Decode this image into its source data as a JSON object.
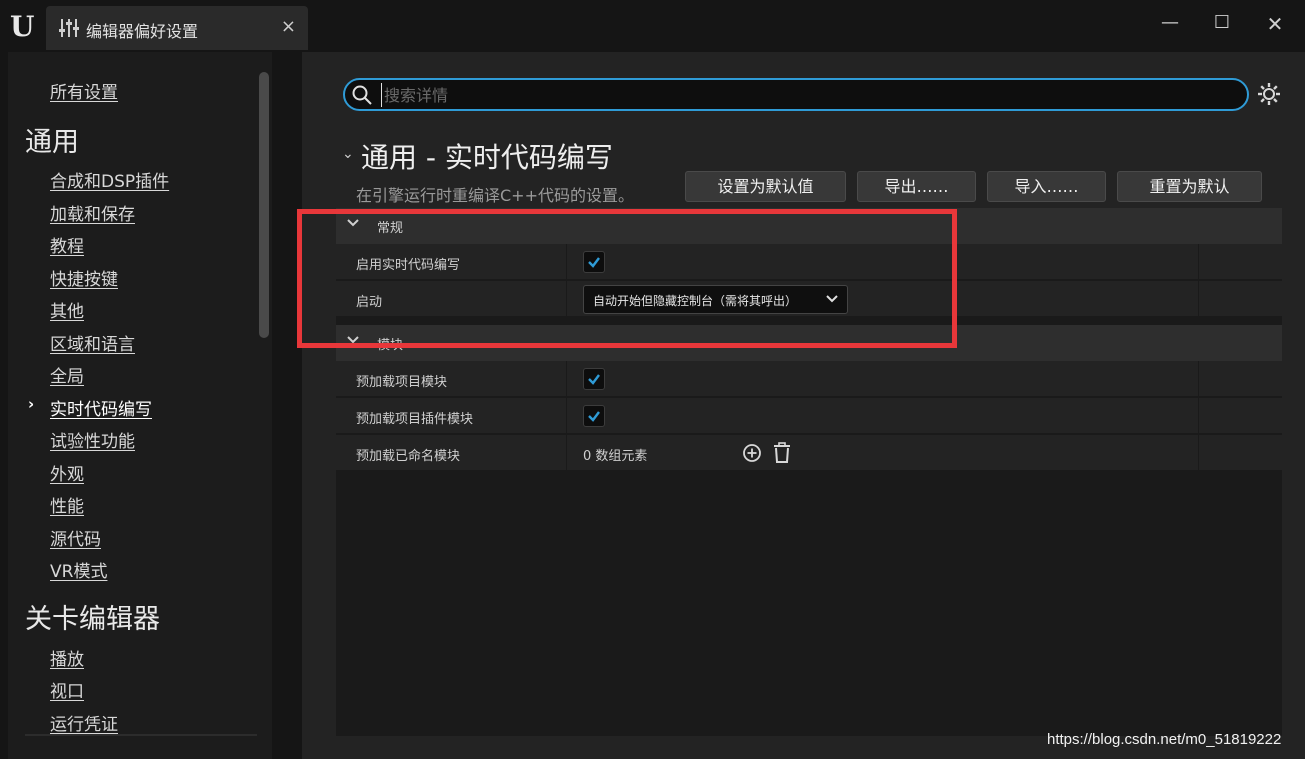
{
  "window": {
    "tab_title": "编辑器偏好设置",
    "tab_close": "×",
    "minimize": "—",
    "maximize": "☐",
    "close": "✕"
  },
  "sidebar": {
    "all_settings": "所有设置",
    "category_general": "通用",
    "items": [
      {
        "label": "合成和DSP插件"
      },
      {
        "label": "加载和保存"
      },
      {
        "label": "教程"
      },
      {
        "label": "快捷按键"
      },
      {
        "label": "其他"
      },
      {
        "label": "区域和语言"
      },
      {
        "label": "全局"
      },
      {
        "label": "实时代码编写"
      },
      {
        "label": "试验性功能"
      },
      {
        "label": "外观"
      },
      {
        "label": "性能"
      },
      {
        "label": "源代码"
      },
      {
        "label": "VR模式"
      }
    ],
    "active_arrow": "›",
    "category_level_editor": "关卡编辑器",
    "level_items": [
      {
        "label": "播放"
      },
      {
        "label": "视口"
      },
      {
        "label": "运行凭证"
      }
    ]
  },
  "search": {
    "placeholder": "搜索详情",
    "value": ""
  },
  "section": {
    "title": "通用 - 实时代码编写",
    "description": "在引擎运行时重编译C++代码的设置。",
    "buttons": {
      "set_default": "设置为默认值",
      "export": "导出……",
      "import": "导入……",
      "reset_default": "重置为默认"
    }
  },
  "groups": {
    "general": {
      "label": "常规",
      "rows": {
        "enable_live_coding": {
          "label": "启用实时代码编写",
          "checked": true
        },
        "startup": {
          "label": "启动",
          "value": "自动开始但隐藏控制台（需将其呼出）"
        }
      }
    },
    "modules": {
      "label": "模块",
      "rows": {
        "preload_project": {
          "label": "预加载项目模块",
          "checked": true
        },
        "preload_plugin": {
          "label": "预加载项目插件模块",
          "checked": true
        },
        "preload_named": {
          "label": "预加载已命名模块",
          "value": "0 数组元素"
        }
      }
    }
  },
  "colors": {
    "accent": "#2f9bd6",
    "highlight_box": "#e8373a",
    "check": "#2f9bd6"
  },
  "watermark": "https://blog.csdn.net/m0_51819222"
}
